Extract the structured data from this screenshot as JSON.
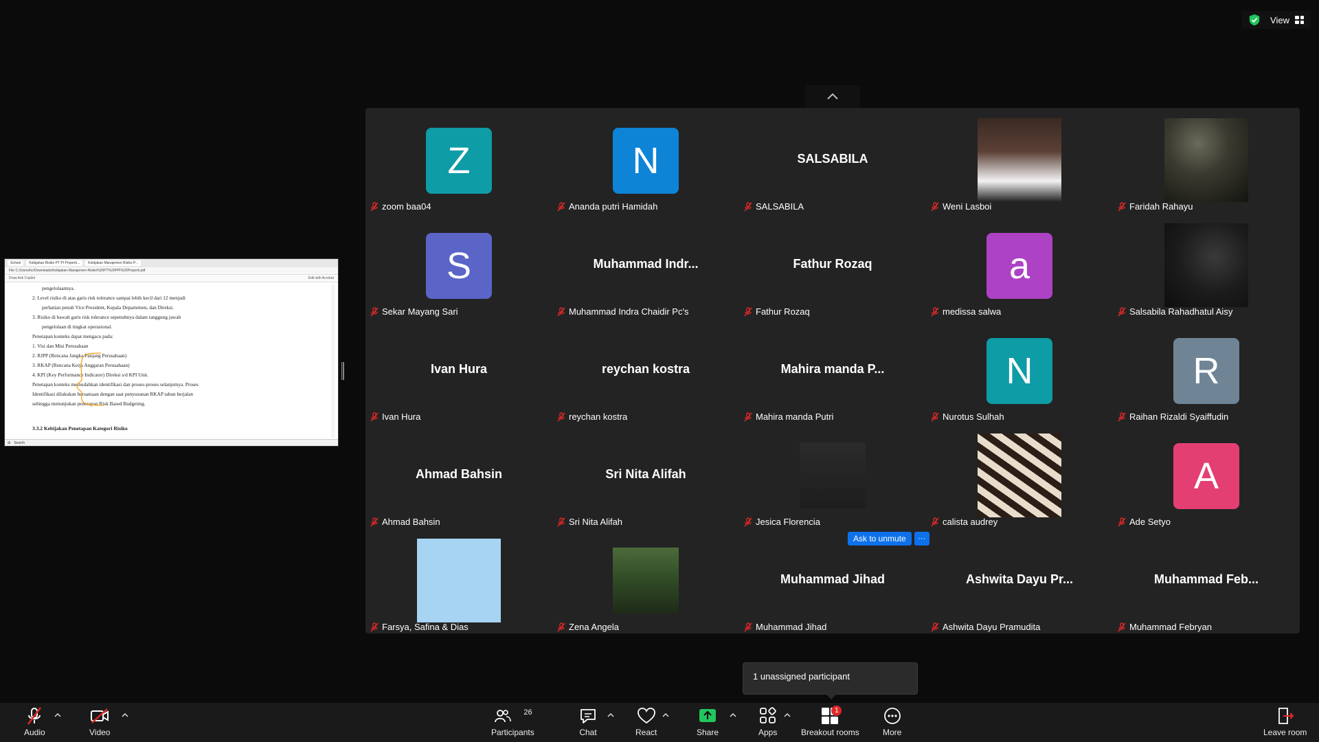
{
  "topbar": {
    "view_label": "View"
  },
  "share": {
    "tabs": [
      "School",
      "Kebijakan Risiko PT PI Properti...",
      "Kebijakan Manajemen Risiko P..."
    ],
    "address": "File  C:/Users/hc/Downloads/Kebijakan-Manajemen-Risiko%20PT%20PPI%20Properti.pdf",
    "toolbar_left": "Draw   Ask Copilot",
    "toolbar_right": "Edit with Acrobat",
    "lines": [
      "pengelolaannya.",
      "2.  Level risiko di atas garis risk tolerance sampai lebih kecil dari 12 menjadi",
      "perhatian penuh Vice President, Kepala Departemen, dan Direksi.",
      "3.  Risiko di bawah garis risk tolerance sepenuhnya dalam tanggung jawab",
      "pengelolaan di tingkat operasional.",
      "Penetapan konteks dapat mengacu pada:",
      "1.  Visi dan Misi Perusahaan",
      "2.  RJPP (Rencana Jangka Panjang Perusahaan)",
      "3.  RKAP (Rencana Kerja Anggaran Perusahaan)",
      "4.  KPI (Key Performance Indicator) Direksi s/d KPI Unit.",
      "Penetapan konteks memudahkan identifikasi dan proses-proses selanjutnya. Proses",
      "Identifikasi dilakukan bersamaan dengan saat penyusunan RKAP tahun berjalan",
      "sehingga menunjukan penerapan Risk Based Budgeting.",
      "3.3.2   Kebijakan Penetapan Kategori Risiko"
    ],
    "taskbar_search": "Search"
  },
  "participants": [
    {
      "label": "zoom baa04",
      "type": "avatar",
      "initial": "Z",
      "color": "#0e9ca6"
    },
    {
      "label": "Ananda putri Hamidah",
      "type": "avatar",
      "initial": "N",
      "color": "#0e84d6"
    },
    {
      "label": "SALSABILA",
      "type": "name",
      "display": "SALSABILA"
    },
    {
      "label": "Weni Lasboi",
      "type": "photo",
      "photo": "weni"
    },
    {
      "label": "Faridah Rahayu",
      "type": "photo",
      "photo": "faridah"
    },
    {
      "label": "Sekar Mayang Sari",
      "type": "avatar",
      "initial": "S",
      "color": "#5a65c7"
    },
    {
      "label": "Muhammad Indra Chaidir Pc's",
      "type": "name",
      "display": "Muhammad  Indr..."
    },
    {
      "label": "Fathur Rozaq",
      "type": "name",
      "display": "Fathur Rozaq"
    },
    {
      "label": "medissa salwa",
      "type": "avatar",
      "initial": "a",
      "color": "#ad42c4"
    },
    {
      "label": "Salsabila Rahadhatul Aisy",
      "type": "photo",
      "photo": "salsabila"
    },
    {
      "label": "Ivan Hura",
      "type": "name",
      "display": "Ivan Hura"
    },
    {
      "label": "reychan kostra",
      "type": "name",
      "display": "reychan kostra"
    },
    {
      "label": "Mahira manda Putri",
      "type": "name",
      "display": "Mahira manda P..."
    },
    {
      "label": "Nurotus Sulhah",
      "type": "avatar",
      "initial": "N",
      "color": "#0e9ca6"
    },
    {
      "label": "Raihan Rizaldi Syaiffudin",
      "type": "avatar",
      "initial": "R",
      "color": "#6f8596"
    },
    {
      "label": "Ahmad Bahsin",
      "type": "name",
      "display": "Ahmad Bahsin"
    },
    {
      "label": "Sri Nita Alifah",
      "type": "name",
      "display": "Sri Nita Alifah"
    },
    {
      "label": "Jesica Florencia",
      "type": "photo",
      "photo": "jesica"
    },
    {
      "label": "calista audrey",
      "type": "photo",
      "photo": "calista"
    },
    {
      "label": "Ade Setyo",
      "type": "avatar",
      "initial": "A",
      "color": "#e43f73"
    },
    {
      "label": "Farsya, Safina & Dias",
      "type": "photo",
      "photo": "farsya"
    },
    {
      "label": "Zena Angela",
      "type": "photo",
      "photo": "zena"
    },
    {
      "label": "Muhammad Jihad",
      "type": "name",
      "display": "Muhammad Jihad"
    },
    {
      "label": "Ashwita Dayu Pramudita",
      "type": "name",
      "display": "Ashwita Dayu Pr..."
    },
    {
      "label": "Muhammad Febryan",
      "type": "name",
      "display": "Muhammad  Feb..."
    }
  ],
  "unmute": {
    "label": "Ask to unmute",
    "more": "···"
  },
  "tooltip": {
    "text": "1 unassigned participant"
  },
  "toolbar": {
    "audio": "Audio",
    "video": "Video",
    "participants": "Participants",
    "participants_count": "26",
    "chat": "Chat",
    "react": "React",
    "share": "Share",
    "apps": "Apps",
    "breakout": "Breakout rooms",
    "breakout_badge": "1",
    "more": "More",
    "leave": "Leave room"
  },
  "colors": {
    "gallery_bg": "#232323",
    "toolbar_bg": "#1a1a1a",
    "accent": "#0e71eb",
    "share_green": "#22c55e",
    "mute_red": "#e02828"
  }
}
